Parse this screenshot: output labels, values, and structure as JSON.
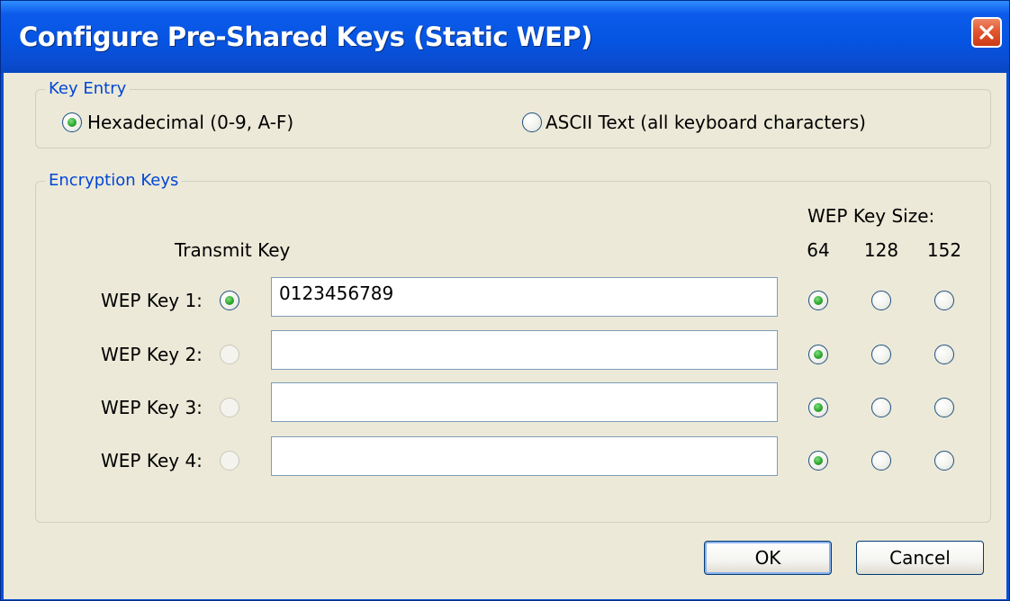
{
  "window": {
    "title": "Configure Pre-Shared Keys (Static WEP)",
    "close_icon": "close-x-icon"
  },
  "key_entry": {
    "title": "Key Entry",
    "options": [
      {
        "label": "Hexadecimal (0-9, A-F)",
        "selected": true
      },
      {
        "label": "ASCII Text (all keyboard characters)",
        "selected": false
      }
    ]
  },
  "encryption_keys": {
    "title": "Encryption Keys",
    "transmit_key_label": "Transmit Key",
    "key_size_label": "WEP Key Size:",
    "sizes": [
      "64",
      "128",
      "152"
    ],
    "keys": [
      {
        "label": "WEP Key 1:",
        "value": "0123456789",
        "transmit": true,
        "size": "64"
      },
      {
        "label": "WEP Key 2:",
        "value": "",
        "transmit": false,
        "size": "64"
      },
      {
        "label": "WEP Key 3:",
        "value": "",
        "transmit": false,
        "size": "64"
      },
      {
        "label": "WEP Key 4:",
        "value": "",
        "transmit": false,
        "size": "64"
      }
    ]
  },
  "buttons": {
    "ok": "OK",
    "cancel": "Cancel"
  },
  "colors": {
    "title_bar": "#0654e2",
    "dialog_bg": "#ece9d8",
    "group_title": "#0046d5",
    "close_button": "#e3562f"
  }
}
